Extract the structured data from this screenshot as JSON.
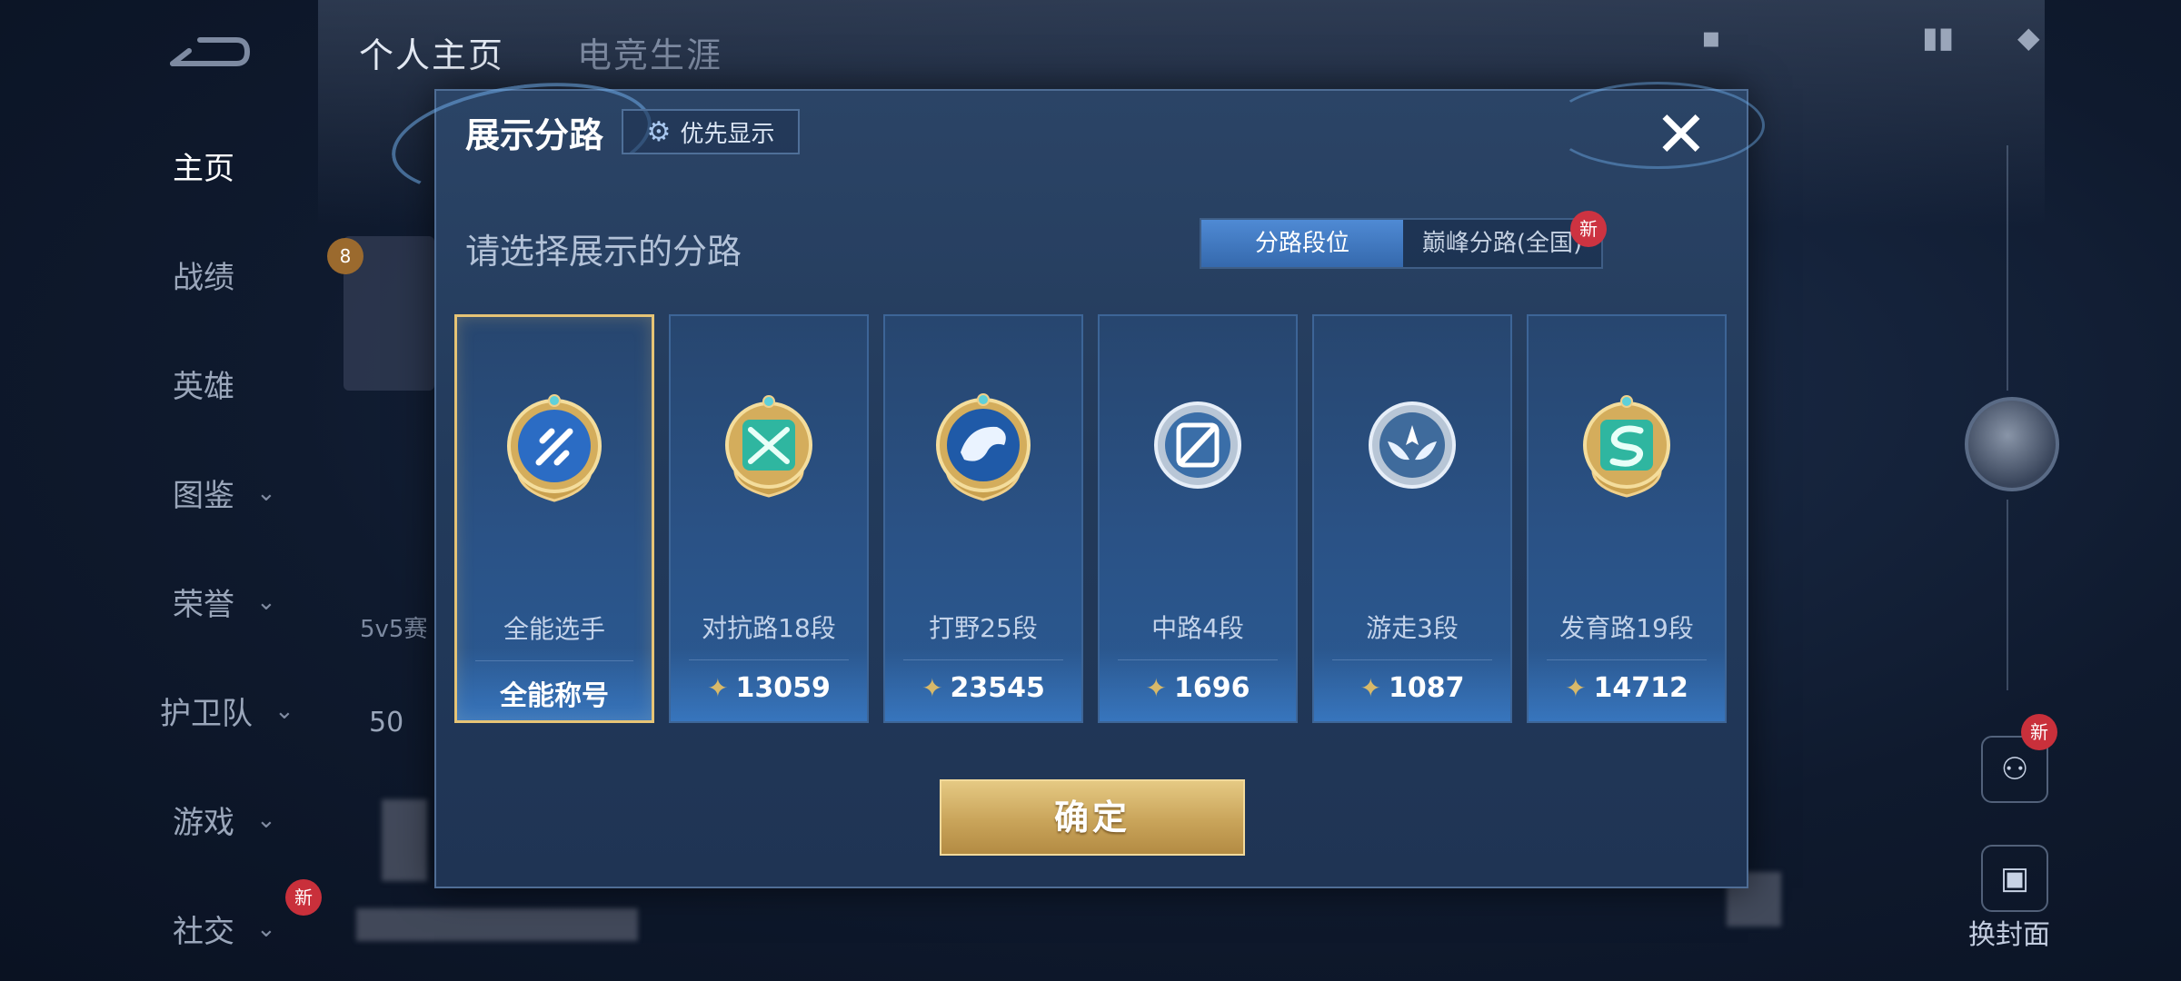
{
  "background": {
    "top_tabs": [
      "个人主页",
      "电竞生涯"
    ],
    "sidebar": [
      {
        "label": "主页",
        "chevron": false
      },
      {
        "label": "战绩",
        "chevron": false
      },
      {
        "label": "英雄",
        "chevron": false
      },
      {
        "label": "图鉴",
        "chevron": true
      },
      {
        "label": "荣誉",
        "chevron": true
      },
      {
        "label": "护卫队",
        "chevron": true
      },
      {
        "label": "游戏",
        "chevron": true
      },
      {
        "label": "社交",
        "chevron": true
      }
    ],
    "new_badge": "新",
    "level_badge": "8",
    "card_label": "5v5赛",
    "side_number": "50",
    "right_button_label": "换封面"
  },
  "dialog": {
    "title": "展示分路",
    "priority_button": "优先显示",
    "subtitle": "请选择展示的分路",
    "segment": {
      "active": "分路段位",
      "inactive": "巅峰分路(全国)",
      "badge": "新"
    },
    "cards": [
      {
        "name": "全能选手",
        "score": "全能称号",
        "emblem": "all-round-emblem-icon",
        "selected": true,
        "show_crystal": false
      },
      {
        "name": "对抗路18段",
        "score": "13059",
        "emblem": "clash-lane-emblem-icon",
        "selected": false,
        "show_crystal": true
      },
      {
        "name": "打野25段",
        "score": "23545",
        "emblem": "jungle-emblem-icon",
        "selected": false,
        "show_crystal": true
      },
      {
        "name": "中路4段",
        "score": "1696",
        "emblem": "mid-lane-emblem-icon",
        "selected": false,
        "show_crystal": true
      },
      {
        "name": "游走3段",
        "score": "1087",
        "emblem": "roam-emblem-icon",
        "selected": false,
        "show_crystal": true
      },
      {
        "name": "发育路19段",
        "score": "14712",
        "emblem": "farm-lane-emblem-icon",
        "selected": false,
        "show_crystal": true
      }
    ],
    "confirm": "确定"
  },
  "colors": {
    "accent_gold": "#e6c476",
    "panel_blue": "#2b4466",
    "badge_red": "#c9303b"
  }
}
